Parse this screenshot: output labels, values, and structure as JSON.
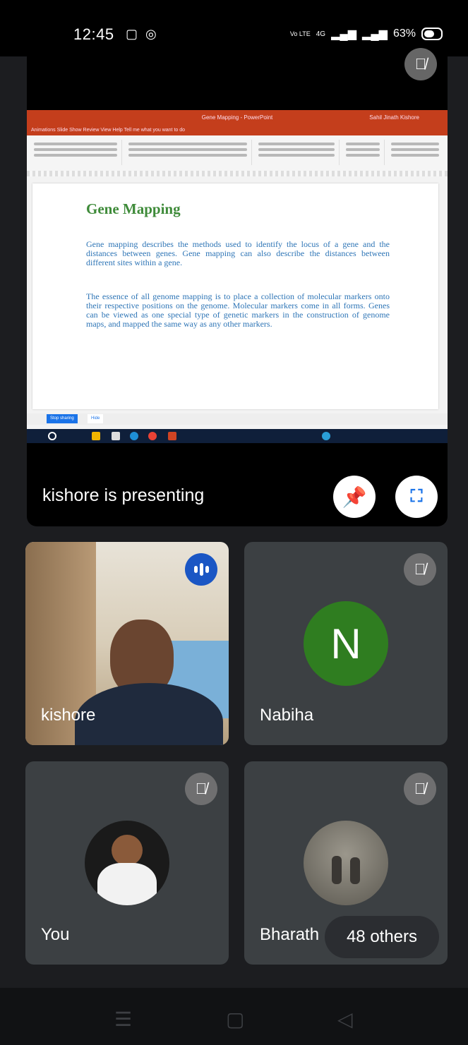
{
  "status_bar": {
    "time": "12:45",
    "network_label": "Vo LTE",
    "signal_label": "4G",
    "battery_percent": "63%"
  },
  "presentation": {
    "presenting_label": "kishore is presenting",
    "window_title": "Gene Mapping - PowerPoint",
    "user_name": "Sahil Jinath Kishore",
    "menu_items": "Animations   Slide Show   Review   View   Help   Tell me what you want to do",
    "slide": {
      "title": "Gene Mapping",
      "paragraph1": "Gene mapping describes the methods used to identify the locus of a gene and the distances between genes. Gene mapping can also describe the distances between different sites within a gene.",
      "paragraph2": "The essence of all genome mapping is to place a collection of molecular markers onto their respective positions on the genome. Molecular markers come in all forms. Genes can be viewed as one special type of genetic markers in the construction of genome maps, and mapped the same way as any other markers."
    },
    "sharing_chip": "Stop sharing",
    "hide_chip": "Hide"
  },
  "participants": [
    {
      "name": "kishore",
      "initial": "",
      "state": "speaking"
    },
    {
      "name": "Nabiha",
      "initial": "N",
      "state": "muted"
    },
    {
      "name": "You",
      "initial": "",
      "state": "muted"
    },
    {
      "name": "Bharath",
      "initial": "",
      "state": "muted"
    }
  ],
  "others_label": "48 others",
  "icons": {
    "mute": "mic-off-icon",
    "pin": "pin-icon",
    "fullscreen": "fullscreen-icon",
    "speaking": "audio-level-icon"
  },
  "colors": {
    "accent": "#1a73e8",
    "nabiha_avatar": "#2f7d20",
    "tile_bg": "#3c4043",
    "ppt_brand": "#c43e1c"
  }
}
